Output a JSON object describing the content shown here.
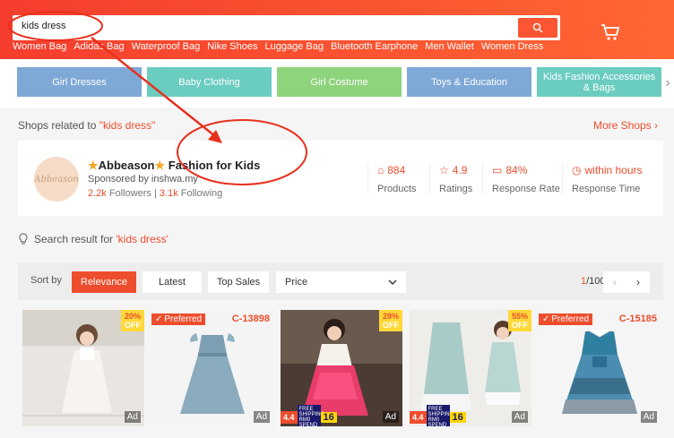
{
  "search": {
    "value": "kids dress"
  },
  "hints": [
    "Women Bag",
    "Adidas Bag",
    "Waterproof Bag",
    "Nike Shoes",
    "Luggage Bag",
    "Bluetooth Earphone",
    "Men Wallet",
    "Women Dress"
  ],
  "categories": [
    {
      "label": "Girl Dresses",
      "color": "#7ea8d6"
    },
    {
      "label": "Baby Clothing",
      "color": "#6bccc0"
    },
    {
      "label": "Girl Costume",
      "color": "#8ed47c"
    },
    {
      "label": "Toys & Education",
      "color": "#7ea8d6"
    },
    {
      "label": "Kids Fashion Accessories & Bags",
      "color": "#6bccc0"
    }
  ],
  "shops": {
    "prefix": "Shops related to ",
    "query": "\"kids dress\"",
    "more": "More Shops"
  },
  "shop": {
    "avatar_text": "Abbeason",
    "name": "Abbeason",
    "name_suffix": "Fashion for Kids",
    "sponsored": "Sponsored by inshwa.my",
    "followers_n": "2.2k",
    "followers_l": "Followers",
    "following_n": "3.1k",
    "following_l": "Following",
    "stats": [
      {
        "value": "884",
        "label": "Products"
      },
      {
        "value": "4.9",
        "label": "Ratings"
      },
      {
        "value": "84%",
        "label": "Response Rate"
      },
      {
        "value": "within hours",
        "label": "Response Time"
      }
    ]
  },
  "result": {
    "prefix": "Search result for ",
    "query": "'kids dress'"
  },
  "sort": {
    "label": "Sort by",
    "relevance": "Relevance",
    "latest": "Latest",
    "top_sales": "Top Sales",
    "price": "Price",
    "page_current": "1",
    "page_total": "/100",
    "prev": "‹",
    "next": "›"
  },
  "products": [
    {
      "discount": "20%",
      "off": "OFF",
      "ad": "Ad"
    },
    {
      "preferred": "Preferred",
      "code": "C-13898",
      "ad": "Ad"
    },
    {
      "discount": "28%",
      "off": "OFF",
      "promo_a": "4.4",
      "promo_b": "FREE SHIPPING RM0 SPEND",
      "promo_c": "16",
      "ad": "Ad"
    },
    {
      "discount": "55%",
      "off": "OFF",
      "promo_a": "4.4",
      "promo_b": "FREE SHIPPING RM0 SPEND",
      "promo_c": "16",
      "ad": "Ad"
    },
    {
      "preferred": "Preferred",
      "code": "C-15185",
      "ad": "Ad"
    }
  ],
  "colors": {
    "brand": "#ee4d2d",
    "annotation": "#e8301e"
  }
}
